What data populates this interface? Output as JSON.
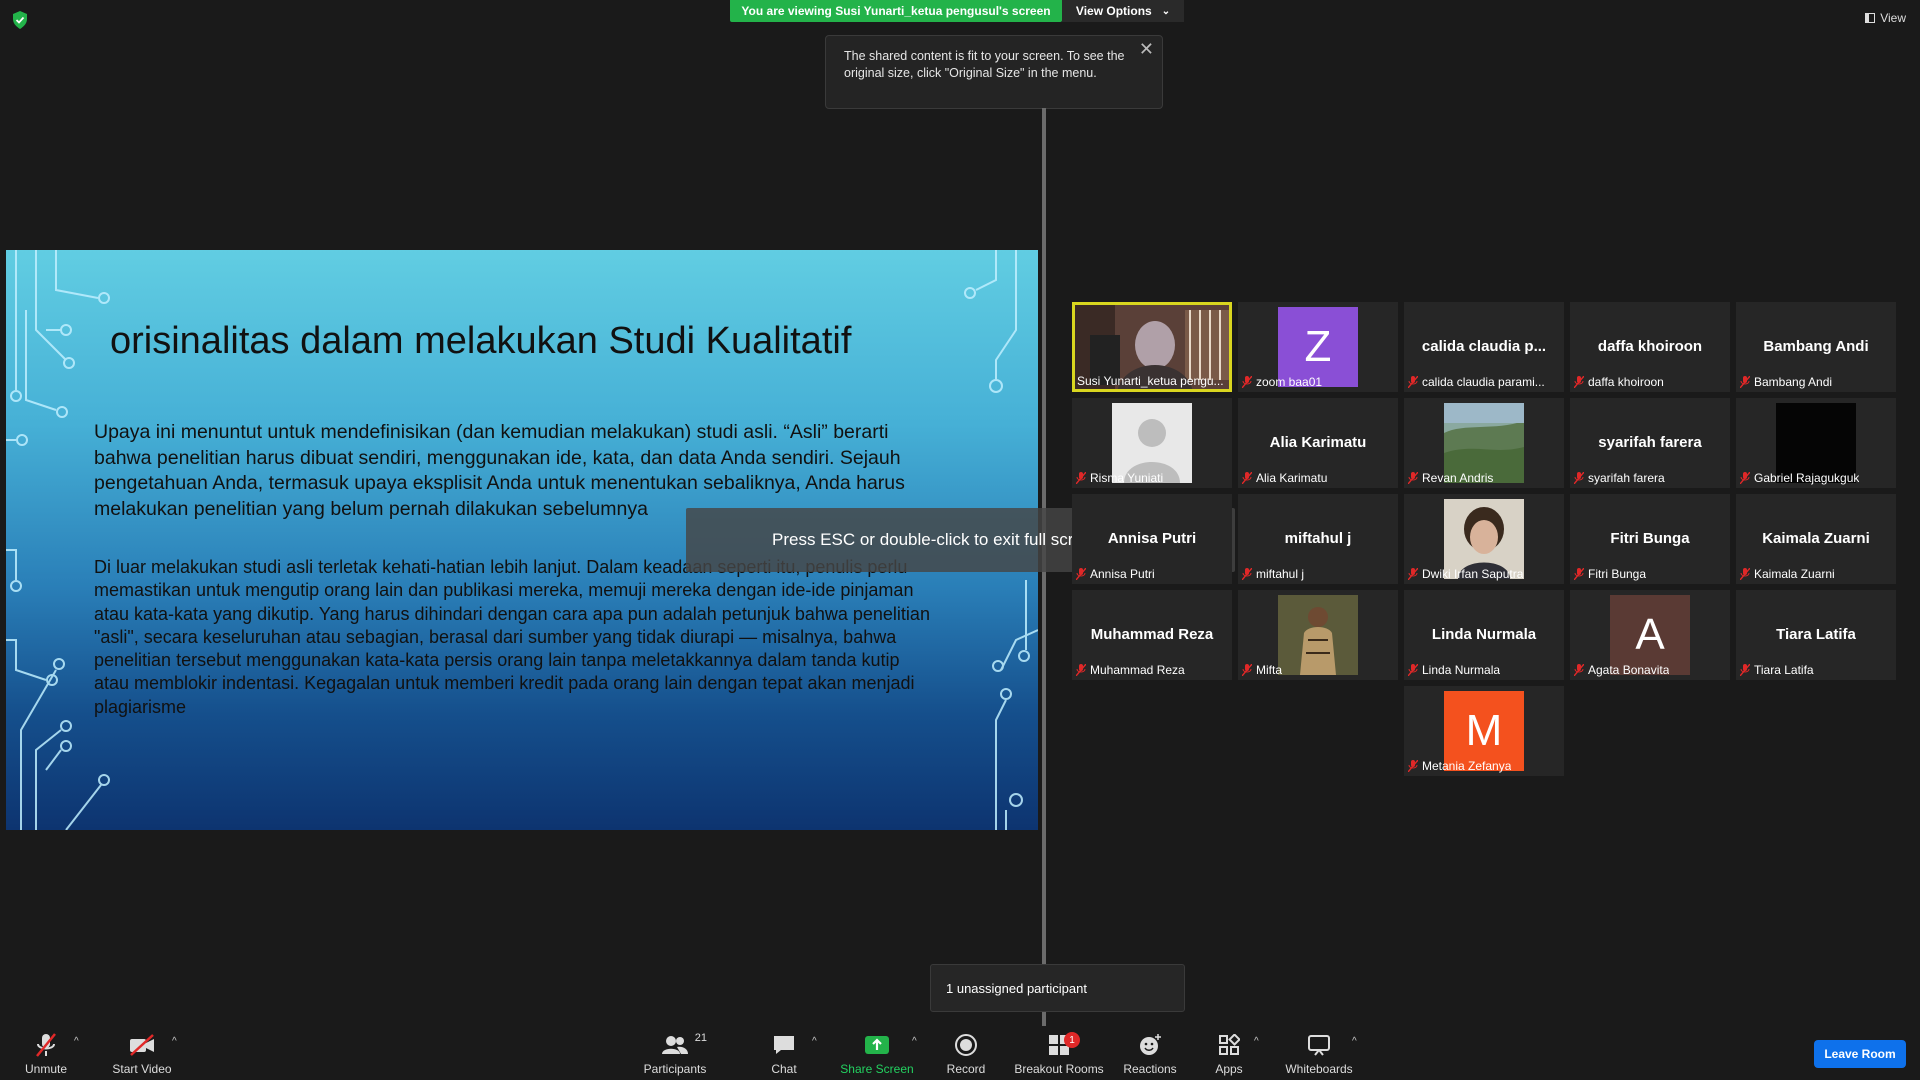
{
  "top": {
    "viewing_banner": "You are viewing Susi Yunarti_ketua pengusul's screen",
    "view_options": "View Options",
    "tooltip": "The shared content is fit to your screen. To see the original size, click \"Original Size\" in the menu.",
    "view_button": "View"
  },
  "slide": {
    "title": "orisinalitas dalam melakukan Studi Kualitatif",
    "paragraph1": "Upaya ini menuntut untuk mendefinisikan (dan kemudian melakukan) studi asli. “Asli” berarti bahwa penelitian harus dibuat sendiri, menggunakan ide, kata, dan data Anda sendiri. Sejauh pengetahuan Anda, termasuk upaya eksplisit Anda untuk menentukan sebaliknya, Anda harus melakukan penelitian yang belum pernah dilakukan sebelumnya",
    "paragraph2": "Di luar melakukan studi asli terletak kehati-hatian lebih lanjut. Dalam keadaan seperti itu, penulis perlu memastikan untuk mengutip orang lain dan publikasi mereka, memuji mereka dengan ide-ide pinjaman atau kata-kata yang dikutip. Yang harus dihindari dengan cara apa pun adalah petunjuk bahwa penelitian \"asli\", secara keseluruhan atau sebagian, berasal dari sumber yang tidak diurapi — misalnya, bahwa penelitian tersebut menggunakan kata-kata persis orang lain tanpa meletakkannya dalam tanda kutip atau memblokir indentasi. Kegagalan untuk memberi kredit pada orang lain dengan tepat akan menjadi plagiarisme"
  },
  "esc_hint": "Press ESC or double-click to exit full screen mode",
  "participants": [
    {
      "label": "Susi Yunarti_ketua pengu...",
      "kind": "photo",
      "photo": "speaker"
    },
    {
      "label": "zoom baa01",
      "kind": "avatar",
      "letter": "Z",
      "color": "#8a4fd6"
    },
    {
      "label": "calida claudia parami...",
      "kind": "name",
      "big": "calida  claudia  p..."
    },
    {
      "label": "daffa khoiroon",
      "kind": "name",
      "big": "daffa khoiroon"
    },
    {
      "label": "Bambang Andi",
      "kind": "name",
      "big": "Bambang Andi"
    },
    {
      "label": "Risma Yuniati",
      "kind": "photo",
      "photo": "default"
    },
    {
      "label": "Alia Karimatu",
      "kind": "name",
      "big": "Alia Karimatu"
    },
    {
      "label": "Revan Andris",
      "kind": "photo",
      "photo": "landscape"
    },
    {
      "label": "syarifah farera",
      "kind": "name",
      "big": "syarifah farera"
    },
    {
      "label": "Gabriel Rajagukguk",
      "kind": "photo",
      "photo": "black"
    },
    {
      "label": "Annisa Putri",
      "kind": "name",
      "big": "Annisa Putri"
    },
    {
      "label": "miftahul j",
      "kind": "name",
      "big": "miftahul j"
    },
    {
      "label": "Dwiki Irfan Saputra",
      "kind": "photo",
      "photo": "portrait"
    },
    {
      "label": "Fitri Bunga",
      "kind": "name",
      "big": "Fitri Bunga"
    },
    {
      "label": "Kaimala Zuarni",
      "kind": "name",
      "big": "Kaimala Zuarni"
    },
    {
      "label": "Muhammad Reza",
      "kind": "name",
      "big": "Muhammad Reza"
    },
    {
      "label": "Mifta",
      "kind": "photo",
      "photo": "person"
    },
    {
      "label": "Linda Nurmala",
      "kind": "name",
      "big": "Linda Nurmala"
    },
    {
      "label": "Agata Bonavita",
      "kind": "avatar",
      "letter": "A",
      "color": "#5a3a34"
    },
    {
      "label": "Tiara Latifa",
      "kind": "name",
      "big": "Tiara Latifa"
    },
    {
      "label": "Metania Zefanya",
      "kind": "avatar",
      "letter": "M",
      "color": "#f4511e"
    }
  ],
  "unassigned": "1 unassigned participant",
  "toolbar": {
    "unmute": "Unmute",
    "start_video": "Start Video",
    "participants": "Participants",
    "participants_count": "21",
    "chat": "Chat",
    "share_screen": "Share Screen",
    "record": "Record",
    "breakout_rooms": "Breakout Rooms",
    "breakout_badge": "1",
    "reactions": "Reactions",
    "apps": "Apps",
    "whiteboards": "Whiteboards",
    "leave": "Leave Room"
  },
  "colors": {
    "share_green": "#23b34a",
    "leave_blue": "#0e71eb",
    "active_speaker": "#d9d61f",
    "muted_red": "#e02828"
  }
}
